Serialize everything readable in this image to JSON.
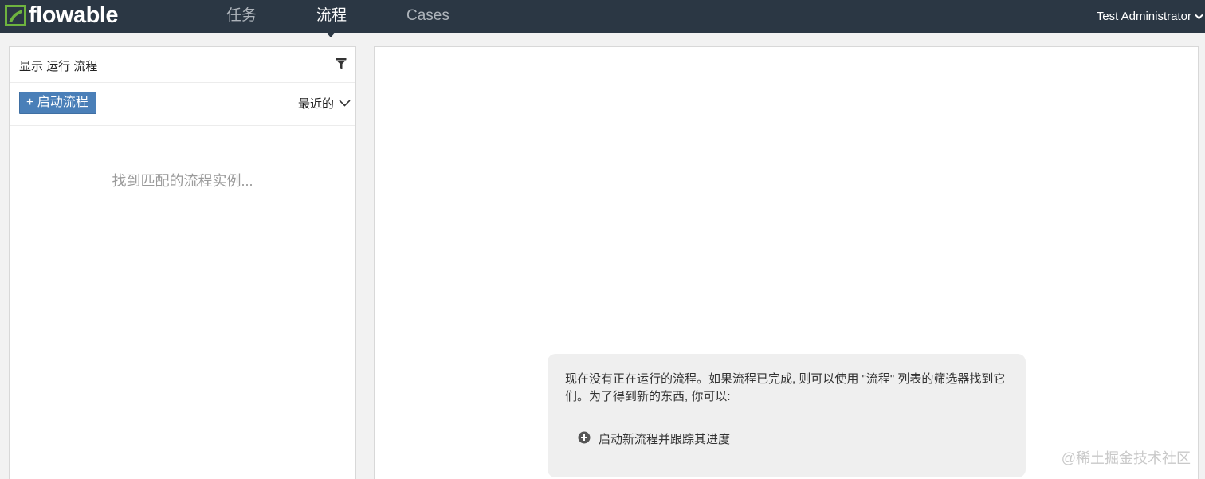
{
  "app": {
    "logo_text": "flowable",
    "brand_color": "#2b3744",
    "logo_color": "#6eb33f"
  },
  "nav": {
    "tabs": [
      {
        "label": "任务",
        "active": false
      },
      {
        "label": "流程",
        "active": true
      },
      {
        "label": "Cases",
        "active": false
      }
    ],
    "user_label": "Test Administrator",
    "user_icon": "chevron-down-icon"
  },
  "left_panel": {
    "title": "显示 运行 流程",
    "filter_icon": "filter-icon",
    "start_button_label": "+ 启动流程",
    "sort_label": "最近的",
    "sort_icon": "chevron-down-icon",
    "empty_message": "找到匹配的流程实例..."
  },
  "right_panel": {
    "help_text": "现在没有正在运行的流程。如果流程已完成, 则可以使用 \"流程\" 列表的筛选器找到它们。为了得到新的东西, 你可以:",
    "help_link_icon": "plus-circle-icon",
    "help_link_label": "启动新流程并跟踪其进度"
  },
  "watermark": "@稀土掘金技术社区"
}
